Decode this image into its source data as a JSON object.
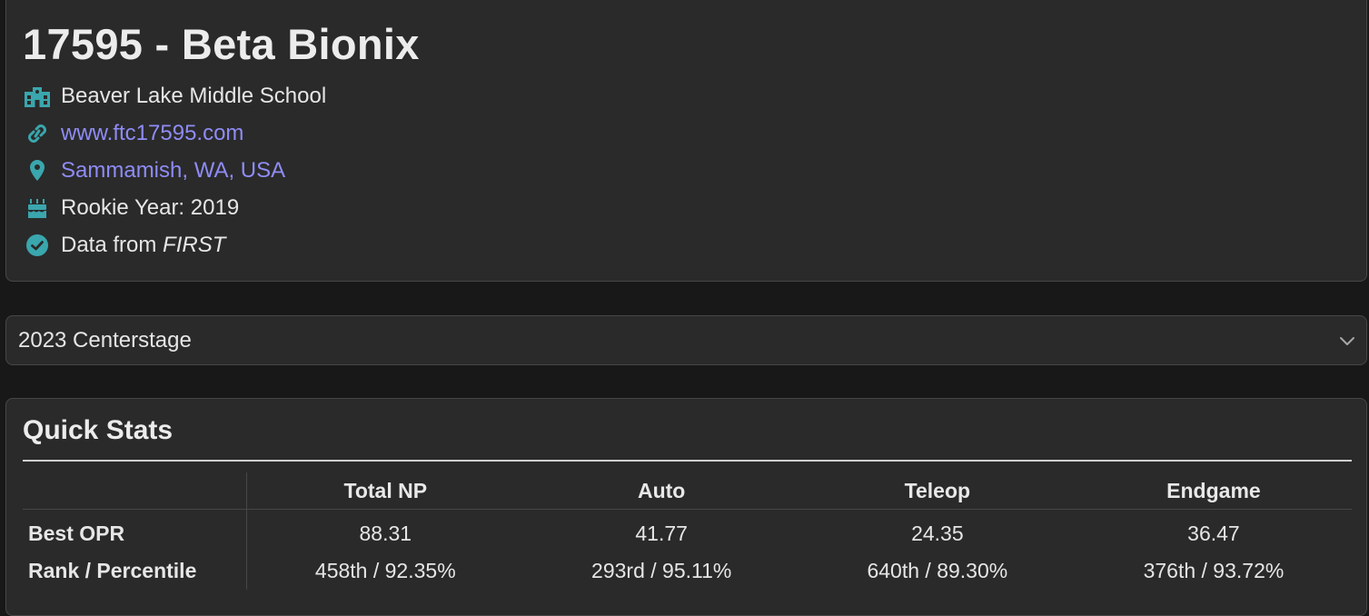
{
  "team": {
    "title": "17595 - Beta Bionix",
    "school": "Beaver Lake Middle School",
    "website": "www.ftc17595.com",
    "location": "Sammamish, WA, USA",
    "rookie_year": "Rookie Year: 2019",
    "data_source_prefix": "Data from ",
    "data_source_name": "FIRST",
    "icons": [
      "school-icon",
      "link-icon",
      "map-pin-icon",
      "cake-icon",
      "verified-check-icon"
    ],
    "icon_color": "#3aa6ad",
    "link_color": "#8f8cf6"
  },
  "season": {
    "selected": "2023 Centerstage",
    "icon": "chevron-down-icon"
  },
  "quick_stats": {
    "title": "Quick Stats",
    "columns": [
      "",
      "Total NP",
      "Auto",
      "Teleop",
      "Endgame"
    ],
    "rows": [
      {
        "label": "Best OPR",
        "values": [
          "88.31",
          "41.77",
          "24.35",
          "36.47"
        ]
      },
      {
        "label": "Rank / Percentile",
        "values": [
          "458th / 92.35%",
          "293rd / 95.11%",
          "640th / 89.30%",
          "376th / 93.72%"
        ]
      }
    ]
  }
}
